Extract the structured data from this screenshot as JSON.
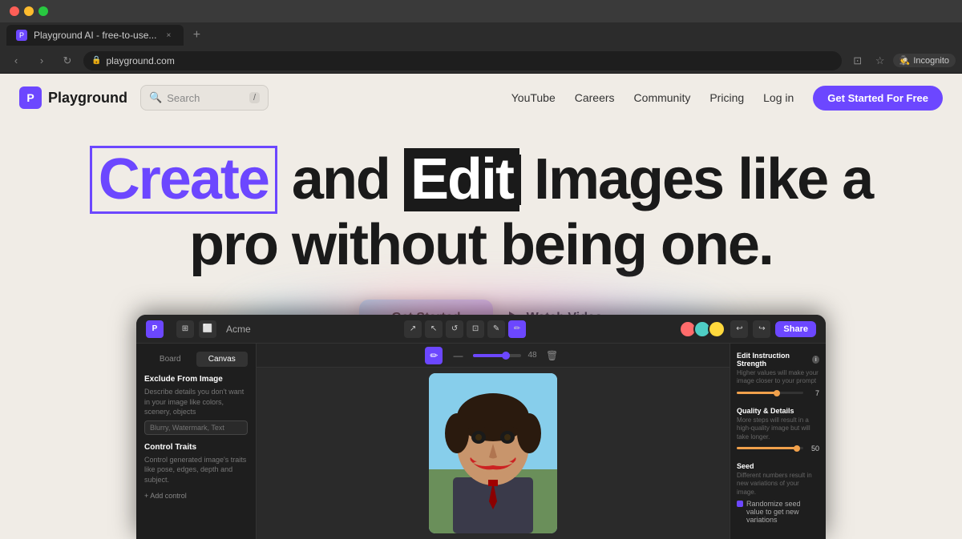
{
  "browser": {
    "tab_title": "Playground AI - free-to-use...",
    "url": "playground.com",
    "new_tab_label": "+",
    "incognito_label": "Incognito"
  },
  "nav": {
    "logo_text": "Playground",
    "logo_icon": "P",
    "search_placeholder": "Search",
    "search_shortcut": "/",
    "links": [
      "YouTube",
      "Careers",
      "Community",
      "Pricing",
      "Log in"
    ],
    "cta": "Get Started For Free"
  },
  "hero": {
    "title_part1": "Create",
    "title_part2": "and",
    "title_part3": "Edit",
    "title_part4": "Images like a",
    "title_part5": "pro without being one.",
    "btn_get_started": "Get Started",
    "btn_watch_video": "Watch Video"
  },
  "app": {
    "toolbar": {
      "logo": "P",
      "filename": "Acme",
      "share_label": "Share"
    },
    "sidebar": {
      "tab_board": "Board",
      "tab_canvas": "Canvas",
      "section1_title": "Exclude From Image",
      "section1_desc": "Describe details you don't want in your image like colors, scenery, objects",
      "section1_placeholder": "Blurry, Watermark, Text",
      "section2_title": "Control Traits",
      "section2_desc": "Control generated image's traits like pose, edges, depth and subject.",
      "add_control": "+ Add control"
    },
    "canvas": {
      "slider_value": "48",
      "delete_icon": "🗑"
    },
    "right_panel": {
      "section1_title": "Edit Instruction Strength",
      "section1_desc": "Higher values will make your image closer to your prompt",
      "section1_value": "7",
      "section2_title": "Quality & Details",
      "section2_desc": "More steps will result in a high-quality image but will take longer.",
      "section2_value": "50",
      "section3_title": "Seed",
      "section3_desc": "Different numbers result in new variations of your image.",
      "section3_checkbox_label": "Randomize seed value to get new variations"
    }
  }
}
